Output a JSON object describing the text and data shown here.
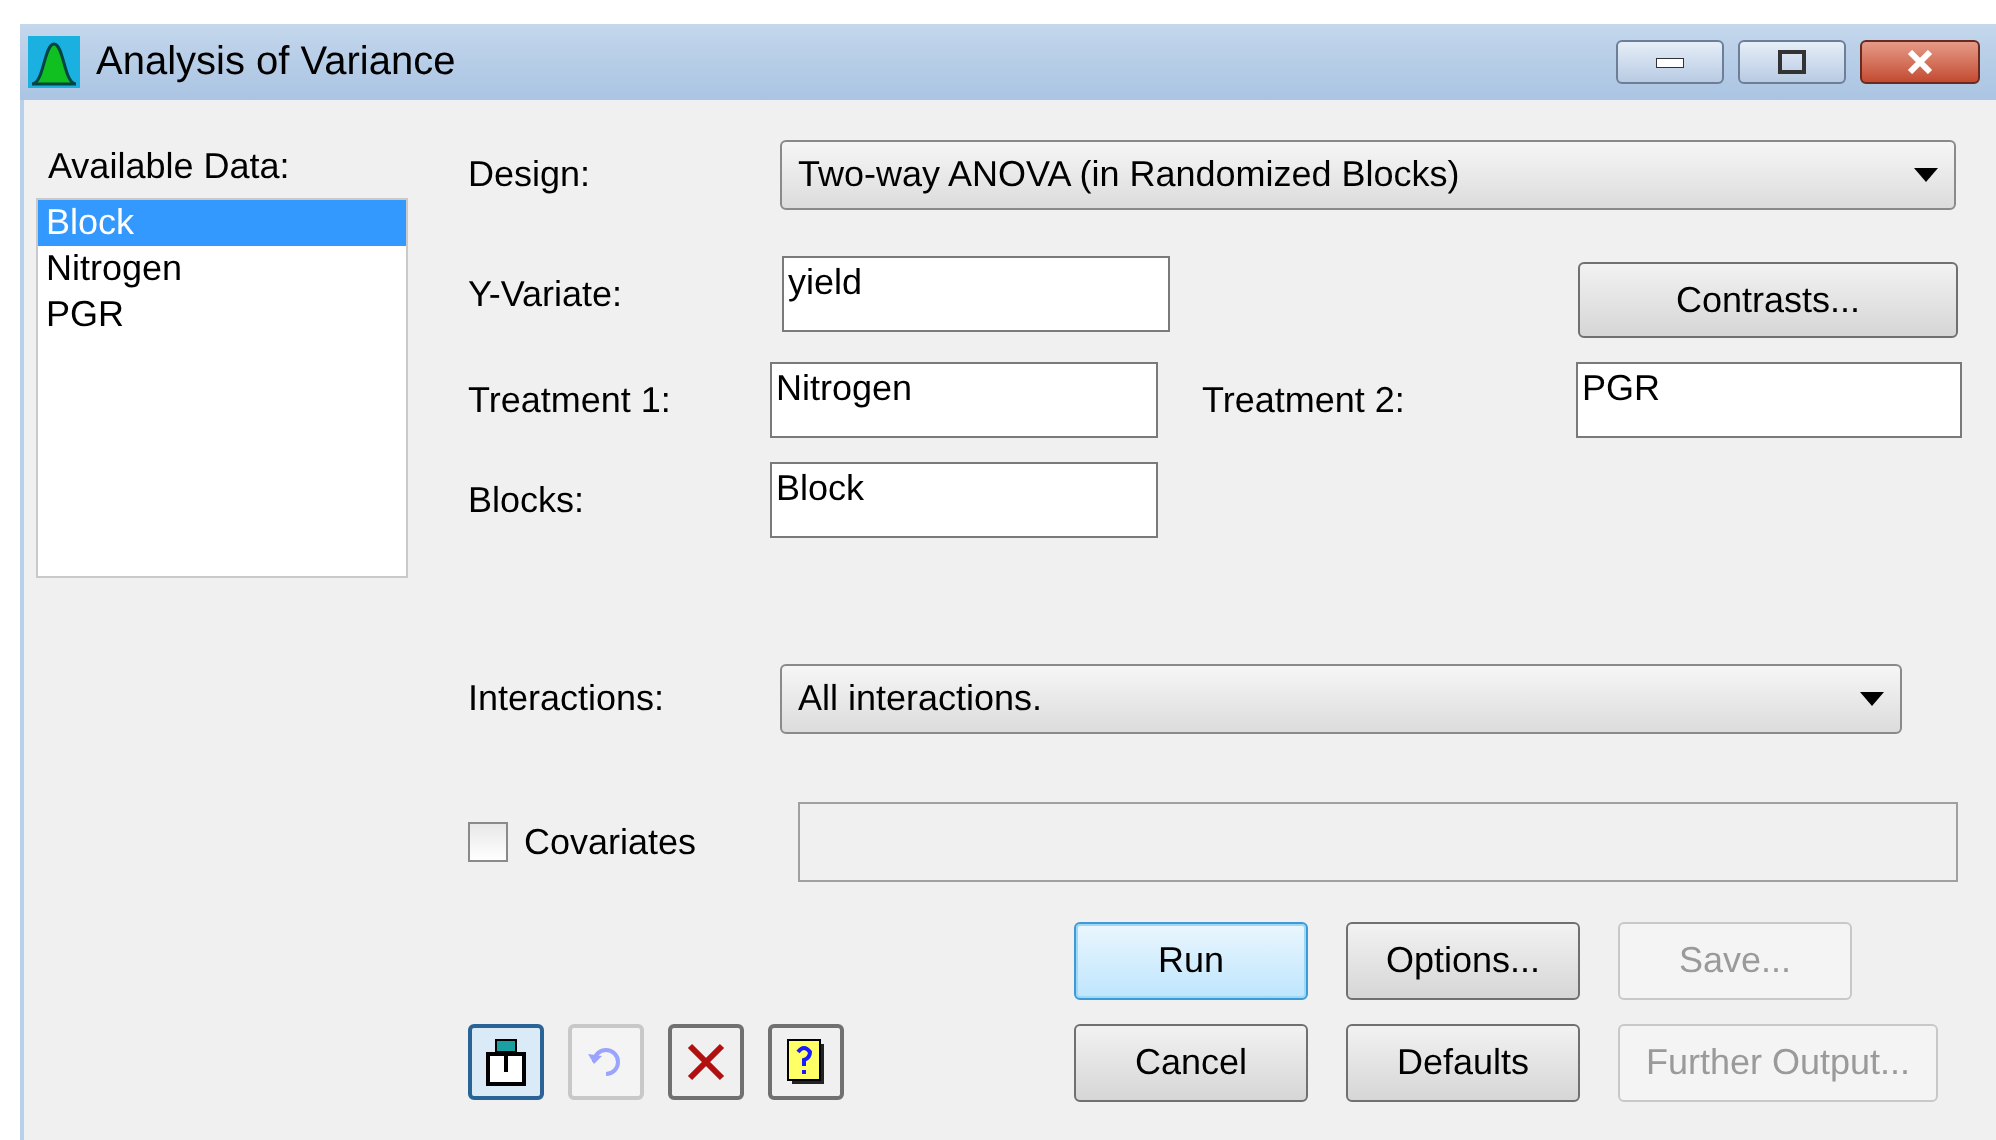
{
  "window": {
    "title": "Analysis of Variance"
  },
  "available_data": {
    "label": "Available Data:",
    "items": [
      {
        "label": "Block",
        "selected": true
      },
      {
        "label": "Nitrogen",
        "selected": false
      },
      {
        "label": "PGR",
        "selected": false
      }
    ]
  },
  "design": {
    "label": "Design:",
    "value": "Two-way ANOVA (in Randomized Blocks)"
  },
  "y_variate": {
    "label": "Y-Variate:",
    "value": "yield"
  },
  "contrasts_button": {
    "label": "Contrasts..."
  },
  "treatment_1": {
    "label": "Treatment 1:",
    "value": "Nitrogen"
  },
  "treatment_2": {
    "label": "Treatment 2:",
    "value": "PGR"
  },
  "blocks": {
    "label": "Blocks:",
    "value": "Block"
  },
  "interactions": {
    "label": "Interactions:",
    "value": "All interactions."
  },
  "covariates": {
    "label": "Covariates",
    "checked": false
  },
  "tools": [
    {
      "kind": "pin",
      "pressed": true,
      "disabled": false
    },
    {
      "kind": "undo",
      "pressed": false,
      "disabled": true
    },
    {
      "kind": "clear",
      "pressed": false,
      "disabled": false
    },
    {
      "kind": "help",
      "pressed": false,
      "disabled": false
    }
  ],
  "buttons": [
    {
      "label": "Run",
      "default": true,
      "disabled": false
    },
    {
      "label": "Options...",
      "default": false,
      "disabled": false
    },
    {
      "label": "Save...",
      "default": false,
      "disabled": true
    },
    {
      "label": "Cancel",
      "default": false,
      "disabled": false
    },
    {
      "label": "Defaults",
      "default": false,
      "disabled": false
    },
    {
      "label": "Further Output...",
      "default": false,
      "disabled": true
    }
  ]
}
